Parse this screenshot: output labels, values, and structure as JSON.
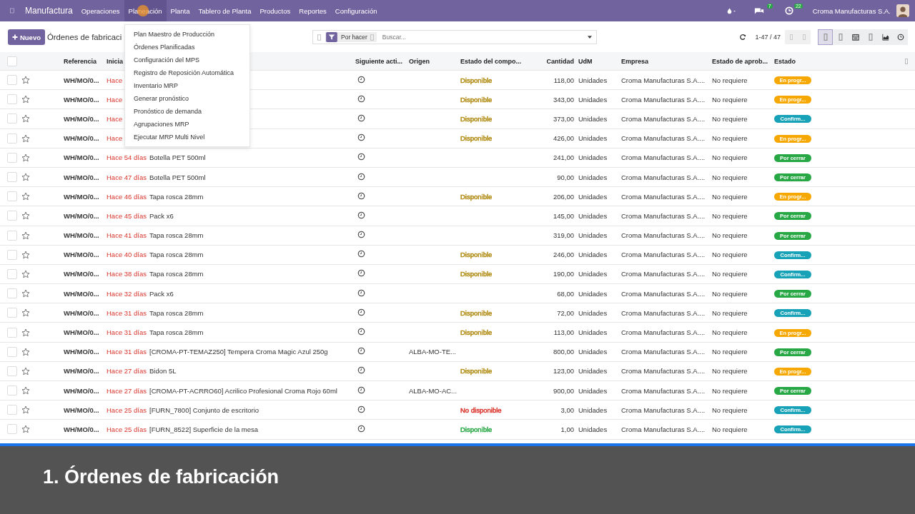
{
  "navbar": {
    "app": "Manufactura",
    "menus": [
      {
        "label": "Operaciones",
        "selected": false
      },
      {
        "label": "Planeación",
        "selected": true
      },
      {
        "label": "Planta",
        "selected": false
      },
      {
        "label": "Tablero de Planta",
        "selected": false
      },
      {
        "label": "Productos",
        "selected": false
      },
      {
        "label": "Reportes",
        "selected": false
      },
      {
        "label": "Configuración",
        "selected": false
      }
    ],
    "messages_count": "7",
    "activities_count": "22",
    "company": "Croma Manufacturas S.A."
  },
  "dropdown": [
    "Plan Maestro de Producción",
    "Órdenes Planificadas",
    "Configuración del MPS",
    "Registro de Reposición Automática",
    "Inventario MRP",
    "Generar pronóstico",
    "Pronóstico de demanda",
    "Agrupaciones MRP",
    "Ejecutar MRP Multi Nivel"
  ],
  "control": {
    "new_button": "Nuevo",
    "title": "Órdenes de fabricaci",
    "facet": "Por hacer",
    "search_placeholder": "Buscar...",
    "pager": "1-47 / 47"
  },
  "select_all_checked": false,
  "columns": [
    "Referencia",
    "Inicia",
    "Siguiente acti...",
    "Origen",
    "Estado del compo...",
    "Cantidad",
    "UdM",
    "Empresa",
    "Estado de aprob...",
    "Estado"
  ],
  "rows": [
    {
      "checked": false,
      "ref": "WH/MO/0...",
      "date": "Hace",
      "product": "",
      "origin": "",
      "component": {
        "label": "Disponible",
        "color": "#b08a10"
      },
      "qty": "118,00",
      "uom": "Unidades",
      "company": "Croma Manufacturas S.A....",
      "approval": "No requiere",
      "state": {
        "label": "En progr...",
        "color": "#f6a800"
      }
    },
    {
      "checked": false,
      "ref": "WH/MO/0...",
      "date": "Hace",
      "product": "",
      "origin": "",
      "component": {
        "label": "Disponible",
        "color": "#b08a10"
      },
      "qty": "343,00",
      "uom": "Unidades",
      "company": "Croma Manufacturas S.A....",
      "approval": "No requiere",
      "state": {
        "label": "En progr...",
        "color": "#f6a800"
      }
    },
    {
      "checked": false,
      "ref": "WH/MO/0...",
      "date": "Hace",
      "product": "",
      "origin": "",
      "component": {
        "label": "Disponible",
        "color": "#b08a10"
      },
      "qty": "373,00",
      "uom": "Unidades",
      "company": "Croma Manufacturas S.A....",
      "approval": "No requiere",
      "state": {
        "label": "Confirm...",
        "color": "#17a2b8"
      }
    },
    {
      "checked": false,
      "ref": "WH/MO/0...",
      "date": "Hace",
      "product": "",
      "origin": "",
      "component": {
        "label": "Disponible",
        "color": "#b08a10"
      },
      "qty": "426,00",
      "uom": "Unidades",
      "company": "Croma Manufacturas S.A....",
      "approval": "No requiere",
      "state": {
        "label": "En progr...",
        "color": "#f6a800"
      }
    },
    {
      "checked": false,
      "ref": "WH/MO/0...",
      "date": "Hace 54 días",
      "product": "Botella PET 500ml",
      "origin": "",
      "qty": "241,00",
      "uom": "Unidades",
      "company": "Croma Manufacturas S.A....",
      "approval": "No requiere",
      "state": {
        "label": "Por cerrar",
        "color": "#28a745"
      }
    },
    {
      "checked": false,
      "ref": "WH/MO/0...",
      "date": "Hace 47 días",
      "product": "Botella PET 500ml",
      "origin": "",
      "qty": "90,00",
      "uom": "Unidades",
      "company": "Croma Manufacturas S.A....",
      "approval": "No requiere",
      "state": {
        "label": "Por cerrar",
        "color": "#28a745"
      }
    },
    {
      "checked": false,
      "ref": "WH/MO/0...",
      "date": "Hace 46 días",
      "product": "Tapa rosca 28mm",
      "origin": "",
      "component": {
        "label": "Disponible",
        "color": "#b08a10"
      },
      "qty": "206,00",
      "uom": "Unidades",
      "company": "Croma Manufacturas S.A....",
      "approval": "No requiere",
      "state": {
        "label": "En progr...",
        "color": "#f6a800"
      }
    },
    {
      "checked": false,
      "ref": "WH/MO/0...",
      "date": "Hace 45 días",
      "product": "Pack x6",
      "origin": "",
      "qty": "145,00",
      "uom": "Unidades",
      "company": "Croma Manufacturas S.A....",
      "approval": "No requiere",
      "state": {
        "label": "Por cerrar",
        "color": "#28a745"
      }
    },
    {
      "checked": false,
      "ref": "WH/MO/0...",
      "date": "Hace 41 días",
      "product": "Tapa rosca 28mm",
      "origin": "",
      "qty": "319,00",
      "uom": "Unidades",
      "company": "Croma Manufacturas S.A....",
      "approval": "No requiere",
      "state": {
        "label": "Por cerrar",
        "color": "#28a745"
      }
    },
    {
      "checked": false,
      "ref": "WH/MO/0...",
      "date": "Hace 40 días",
      "product": "Tapa rosca 28mm",
      "origin": "",
      "component": {
        "label": "Disponible",
        "color": "#b08a10"
      },
      "qty": "246,00",
      "uom": "Unidades",
      "company": "Croma Manufacturas S.A....",
      "approval": "No requiere",
      "state": {
        "label": "Confirm...",
        "color": "#17a2b8"
      }
    },
    {
      "checked": false,
      "ref": "WH/MO/0...",
      "date": "Hace 38 días",
      "product": "Tapa rosca 28mm",
      "origin": "",
      "component": {
        "label": "Disponible",
        "color": "#b08a10"
      },
      "qty": "190,00",
      "uom": "Unidades",
      "company": "Croma Manufacturas S.A....",
      "approval": "No requiere",
      "state": {
        "label": "Confirm...",
        "color": "#17a2b8"
      }
    },
    {
      "checked": false,
      "ref": "WH/MO/0...",
      "date": "Hace 32 días",
      "product": "Pack x6",
      "origin": "",
      "qty": "68,00",
      "uom": "Unidades",
      "company": "Croma Manufacturas S.A....",
      "approval": "No requiere",
      "state": {
        "label": "Por cerrar",
        "color": "#28a745"
      }
    },
    {
      "checked": false,
      "ref": "WH/MO/0...",
      "date": "Hace 31 días",
      "product": "Tapa rosca 28mm",
      "origin": "",
      "component": {
        "label": "Disponible",
        "color": "#b08a10"
      },
      "qty": "72,00",
      "uom": "Unidades",
      "company": "Croma Manufacturas S.A....",
      "approval": "No requiere",
      "state": {
        "label": "Confirm...",
        "color": "#17a2b8"
      }
    },
    {
      "checked": false,
      "ref": "WH/MO/0...",
      "date": "Hace 31 días",
      "product": "Tapa rosca 28mm",
      "origin": "",
      "component": {
        "label": "Disponible",
        "color": "#b08a10"
      },
      "qty": "113,00",
      "uom": "Unidades",
      "company": "Croma Manufacturas S.A....",
      "approval": "No requiere",
      "state": {
        "label": "En progr...",
        "color": "#f6a800"
      }
    },
    {
      "checked": false,
      "ref": "WH/MO/0...",
      "date": "Hace 31 días",
      "product": "[CROMA-PT-TEMAZ250] Tempera Croma Magic Azul 250g",
      "origin": "ALBA-MO-TE...",
      "qty": "800,00",
      "uom": "Unidades",
      "company": "Croma Manufacturas S.A....",
      "approval": "No requiere",
      "state": {
        "label": "Por cerrar",
        "color": "#28a745"
      }
    },
    {
      "checked": false,
      "ref": "WH/MO/0...",
      "date": "Hace 27 días",
      "product": "Bidon 5L",
      "origin": "",
      "component": {
        "label": "Disponible",
        "color": "#b08a10"
      },
      "qty": "123,00",
      "uom": "Unidades",
      "company": "Croma Manufacturas S.A....",
      "approval": "No requiere",
      "state": {
        "label": "En progr...",
        "color": "#f6a800"
      }
    },
    {
      "checked": false,
      "ref": "WH/MO/0...",
      "date": "Hace 27 días",
      "product": "[CROMA-PT-ACRRO60] Acrilico Profesional Croma Rojo 60ml",
      "origin": "ALBA-MO-AC...",
      "qty": "900,00",
      "uom": "Unidades",
      "company": "Croma Manufacturas S.A....",
      "approval": "No requiere",
      "state": {
        "label": "Por cerrar",
        "color": "#28a745"
      }
    },
    {
      "checked": false,
      "ref": "WH/MO/0...",
      "date": "Hace 25 días",
      "product": "[FURN_7800] Conjunto de escritorio",
      "origin": "",
      "component": {
        "label": "No disponible",
        "color": "#d9342b"
      },
      "qty": "3,00",
      "uom": "Unidades",
      "company": "Croma Manufacturas S.A....",
      "approval": "No requiere",
      "state": {
        "label": "Confirm...",
        "color": "#17a2b8"
      }
    },
    {
      "checked": false,
      "ref": "WH/MO/0...",
      "date": "Hace 25 días",
      "product": "[FURN_8522] Superficie de la mesa",
      "origin": "",
      "component": {
        "label": "Disponible",
        "color": "#28a745"
      },
      "qty": "1,00",
      "uom": "Unidades",
      "company": "Croma Manufacturas S.A....",
      "approval": "No requiere",
      "state": {
        "label": "Confirm...",
        "color": "#17a2b8"
      }
    }
  ],
  "caption": "1. Órdenes de fabricación"
}
